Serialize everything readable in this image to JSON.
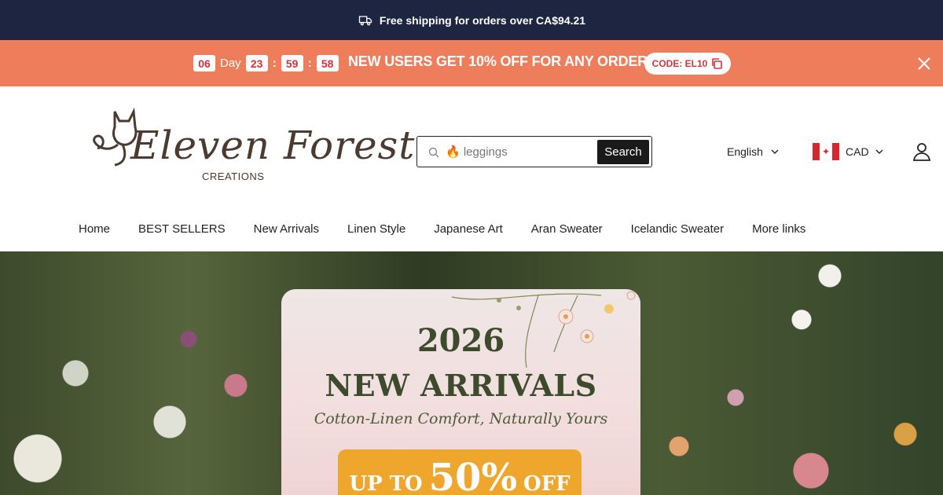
{
  "shipping_bar": {
    "text": "Free shipping for orders over CA$94.21",
    "icon": "truck-icon"
  },
  "promo_bar": {
    "countdown": {
      "days": "06",
      "day_label": "Day",
      "hours": "23",
      "minutes": "59",
      "seconds": "58",
      "separator": ":"
    },
    "text": "NEW USERS GET 10% OFF FOR ANY ORDER",
    "code": "CODE: EL10",
    "copy_icon": "copy-icon",
    "close_icon": "close-icon",
    "bg_color": "#ee7d5c"
  },
  "header": {
    "logo": {
      "script": "Eleven Forest",
      "sub": "CREATIONS"
    },
    "search": {
      "value": "🔥 leggings",
      "button": "Search"
    },
    "language": "English",
    "currency": "CAD",
    "flag_icon": "canada-flag-icon",
    "user_icon": "user-icon"
  },
  "nav": {
    "items": [
      "Home",
      "BEST SELLERS",
      "New Arrivals",
      "Linen Style",
      "Japanese Art",
      "Aran Sweater",
      "Icelandic Sweater",
      "More links"
    ]
  },
  "hero": {
    "year": "2026",
    "title": "NEW ARRIVALS",
    "subtitle": "Cotton-Linen Comfort, Naturally Yours",
    "badge_prefix": "UP TO",
    "badge_value": "50%",
    "badge_suffix": "OFF"
  },
  "colors": {
    "top_bar": "#1e2540",
    "promo": "#ee7d5c",
    "badge": "#eea62d",
    "hero_text": "#3e4a2c"
  }
}
